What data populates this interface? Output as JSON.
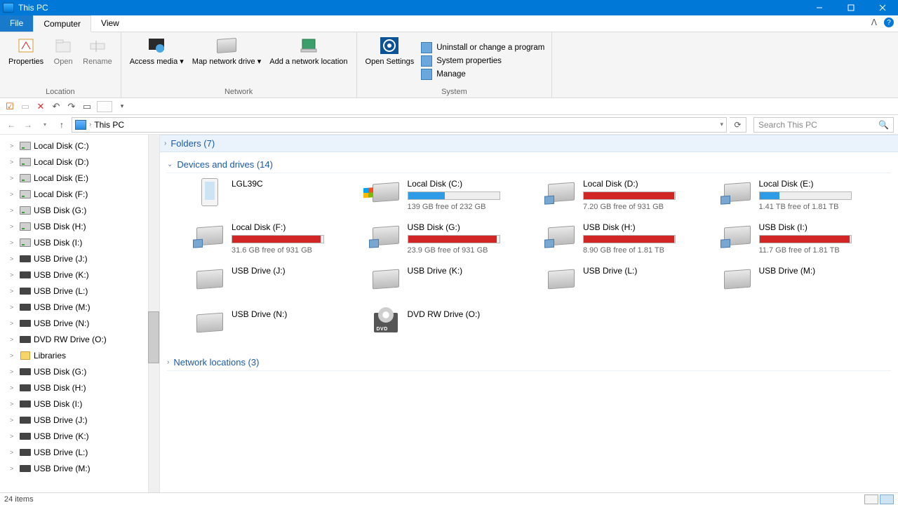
{
  "title": "This PC",
  "tabs": {
    "file": "File",
    "computer": "Computer",
    "view": "View"
  },
  "ribbon": {
    "location": {
      "caption": "Location",
      "properties": "Properties",
      "open": "Open",
      "rename": "Rename"
    },
    "network": {
      "caption": "Network",
      "access_media": "Access media",
      "map_drive": "Map network drive",
      "add_location": "Add a network location"
    },
    "system": {
      "open_settings": "Open Settings",
      "uninstall": "Uninstall or change a program",
      "sysprops": "System properties",
      "manage": "Manage",
      "caption": "System"
    }
  },
  "breadcrumb": {
    "root": "This PC"
  },
  "search_placeholder": "Search This PC",
  "sections": {
    "folders": "Folders (7)",
    "devices": "Devices and drives (14)",
    "network": "Network locations (3)"
  },
  "tree": [
    {
      "label": "Local Disk (C:)",
      "icon": "drive"
    },
    {
      "label": "Local Disk  (D:)",
      "icon": "drive"
    },
    {
      "label": "Local Disk  (E:)",
      "icon": "drive"
    },
    {
      "label": "Local Disk  (F:)",
      "icon": "drive"
    },
    {
      "label": "USB Disk (G:)",
      "icon": "drive"
    },
    {
      "label": "USB Disk (H:)",
      "icon": "drive"
    },
    {
      "label": "USB Disk (I:)",
      "icon": "drive"
    },
    {
      "label": "USB Drive (J:)",
      "icon": "usb"
    },
    {
      "label": "USB Drive (K:)",
      "icon": "usb"
    },
    {
      "label": "USB Drive (L:)",
      "icon": "usb"
    },
    {
      "label": "USB Drive (M:)",
      "icon": "usb"
    },
    {
      "label": "USB Drive (N:)",
      "icon": "usb"
    },
    {
      "label": "DVD RW Drive (O:)",
      "icon": "usb"
    },
    {
      "label": "Libraries",
      "icon": "lib"
    },
    {
      "label": "USB Disk (G:)",
      "icon": "usb"
    },
    {
      "label": "USB Disk (H:)",
      "icon": "usb"
    },
    {
      "label": "USB Disk (I:)",
      "icon": "usb"
    },
    {
      "label": "USB Drive (J:)",
      "icon": "usb"
    },
    {
      "label": "USB Drive (K:)",
      "icon": "usb"
    },
    {
      "label": "USB Drive (L:)",
      "icon": "usb"
    },
    {
      "label": "USB Drive (M:)",
      "icon": "usb"
    }
  ],
  "drives": [
    {
      "name": "LGL39C",
      "icon": "phone"
    },
    {
      "name": "Local Disk (C:)",
      "icon": "win",
      "fill": 40,
      "color": "#2e9be6",
      "free": "139 GB free of 232 GB"
    },
    {
      "name": "Local Disk  (D:)",
      "icon": "badge",
      "fill": 99,
      "color": "#d22626",
      "free": "7.20 GB free of 931 GB"
    },
    {
      "name": "Local Disk  (E:)",
      "icon": "badge",
      "fill": 22,
      "color": "#2e9be6",
      "free": "1.41 TB free of 1.81 TB"
    },
    {
      "name": "Local Disk  (F:)",
      "icon": "badge",
      "fill": 97,
      "color": "#d22626",
      "free": "31.6 GB free of 931 GB"
    },
    {
      "name": "USB Disk (G:)",
      "icon": "badge",
      "fill": 97,
      "color": "#d22626",
      "free": "23.9 GB free of 931 GB"
    },
    {
      "name": "USB Disk (H:)",
      "icon": "badge",
      "fill": 99,
      "color": "#d22626",
      "free": "8.90 GB free of 1.81 TB"
    },
    {
      "name": "USB Disk (I:)",
      "icon": "badge",
      "fill": 99,
      "color": "#d22626",
      "free": "11.7 GB free of 1.81 TB"
    },
    {
      "name": "USB Drive (J:)",
      "icon": "plain"
    },
    {
      "name": "USB Drive (K:)",
      "icon": "plain"
    },
    {
      "name": "USB Drive (L:)",
      "icon": "plain"
    },
    {
      "name": "USB Drive (M:)",
      "icon": "plain"
    },
    {
      "name": "USB Drive (N:)",
      "icon": "plain"
    },
    {
      "name": "DVD RW Drive (O:)",
      "icon": "dvd"
    }
  ],
  "status": "24 items"
}
